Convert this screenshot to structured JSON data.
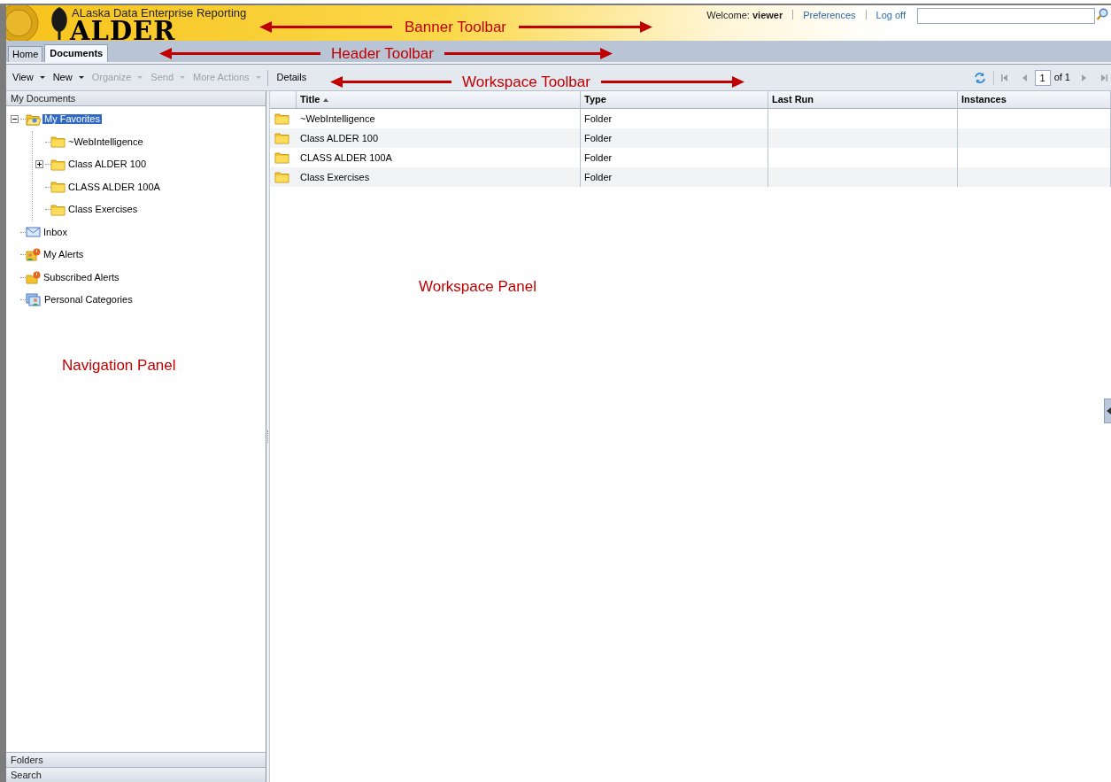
{
  "banner": {
    "subtitle": "ALaska Data Enterprise Reporting",
    "logo": "ALDER",
    "welcome_label": "Welcome:",
    "user": "viewer",
    "links": [
      "Preferences",
      "Log off"
    ]
  },
  "tabs": [
    {
      "label": "Home",
      "selected": false
    },
    {
      "label": "Documents",
      "selected": true
    }
  ],
  "toolbar": {
    "menus": [
      {
        "label": "View",
        "disabled": false
      },
      {
        "label": "New",
        "disabled": false
      },
      {
        "label": "Organize",
        "disabled": true
      },
      {
        "label": "Send",
        "disabled": true
      },
      {
        "label": "More Actions",
        "disabled": true
      }
    ],
    "details": "Details",
    "page": "1",
    "page_of": "of 1"
  },
  "navigation": {
    "title": "My Documents",
    "tree": [
      {
        "label": "My Favorites",
        "kind": "favorites",
        "selected": true,
        "expanded": true,
        "children": [
          {
            "label": "~WebIntelligence",
            "kind": "folder",
            "selected": false
          },
          {
            "label": "Class ALDER 100",
            "kind": "folder",
            "selected": false,
            "expanded": false
          },
          {
            "label": "CLASS ALDER 100A",
            "kind": "folder",
            "selected": false
          },
          {
            "label": "Class Exercises",
            "kind": "folder",
            "selected": false
          }
        ]
      },
      {
        "label": "Inbox",
        "kind": "inbox",
        "selected": false
      },
      {
        "label": "My Alerts",
        "kind": "alerts",
        "selected": false
      },
      {
        "label": "Subscribed Alerts",
        "kind": "subscribed",
        "selected": false
      },
      {
        "label": "Personal Categories",
        "kind": "categories",
        "selected": false
      }
    ],
    "sections": [
      "Folders",
      "Search"
    ]
  },
  "table": {
    "columns": [
      {
        "label": "Title",
        "sorted": true
      },
      {
        "label": "Type",
        "sorted": false
      },
      {
        "label": "Last Run",
        "sorted": false
      },
      {
        "label": "Instances",
        "sorted": false
      }
    ],
    "rows": [
      {
        "title": "~WebIntelligence",
        "type": "Folder"
      },
      {
        "title": "Class ALDER 100",
        "type": "Folder"
      },
      {
        "title": "CLASS ALDER 100A",
        "type": "Folder"
      },
      {
        "title": "Class Exercises",
        "type": "Folder"
      }
    ]
  },
  "annotations": [
    {
      "label": "Banner Toolbar",
      "kind": "arrowed"
    },
    {
      "label": "Header Toolbar",
      "kind": "arrowed"
    },
    {
      "label": "Workspace Toolbar",
      "kind": "arrowed"
    },
    {
      "label": "Workspace Panel",
      "kind": "plain"
    },
    {
      "label": "Navigation Panel",
      "kind": "plain"
    }
  ]
}
